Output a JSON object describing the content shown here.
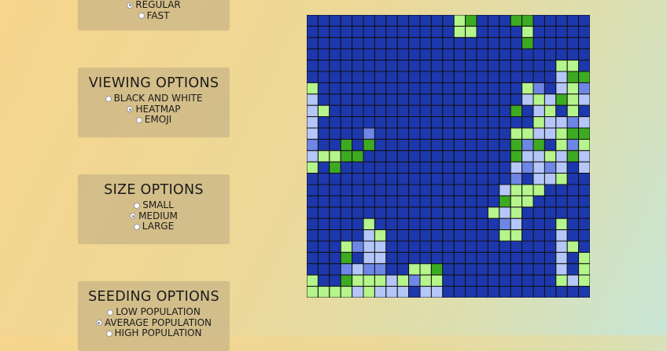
{
  "speed_options": {
    "options": [
      {
        "label": "REGULAR",
        "selected": true
      },
      {
        "label": "FAST",
        "selected": false
      }
    ]
  },
  "viewing_options": {
    "title": "VIEWING OPTIONS",
    "options": [
      {
        "label": "BLACK AND WHITE",
        "selected": false
      },
      {
        "label": "HEATMAP",
        "selected": true
      },
      {
        "label": "EMOJI",
        "selected": false
      }
    ]
  },
  "size_options": {
    "title": "SIZE OPTIONS",
    "options": [
      {
        "label": "SMALL",
        "selected": false
      },
      {
        "label": "MEDIUM",
        "selected": true
      },
      {
        "label": "LARGE",
        "selected": false
      }
    ]
  },
  "seeding_options": {
    "title": "SEEDING OPTIONS",
    "options": [
      {
        "label": "LOW POPULATION",
        "selected": false
      },
      {
        "label": "AVERAGE POPULATION",
        "selected": true
      },
      {
        "label": "HIGH POPULATION",
        "selected": false
      }
    ]
  },
  "grid": {
    "cols": 25,
    "rows": 25,
    "colors": {
      "0": "#1d38ad",
      "1": "#3dab21",
      "2": "#b5f58c",
      "3": "#b5c7f8",
      "4": "#6e86e6"
    },
    "cells": [
      "0000000000000210001100000",
      "0000000000000220000200000",
      "0000000000000000000100000",
      "0000000000000000000000000",
      "0000000000000000000000220",
      "0000000000000000000000311",
      "2000000000000000000240324",
      "3000000000000000000323123",
      "3200000000000000001032020",
      "3000000000000000000023343",
      "3000040000000000002233211",
      "4001010000000000001410242",
      "3221100000000000001332313",
      "2010000000000000003434303",
      "0000000000000000004033200",
      "0000000000000000032220000",
      "0000000000000000012200000",
      "0000000000000000232000000",
      "0000020000000000043000200",
      "0000032000000000022000300",
      "0002433000000000000000320",
      "0001033000000000000000302",
      "0004344002210000000000302",
      "2001222324220000000000232",
      "2222323330330000000000000",
      "0000000000000000000000000"
    ]
  }
}
